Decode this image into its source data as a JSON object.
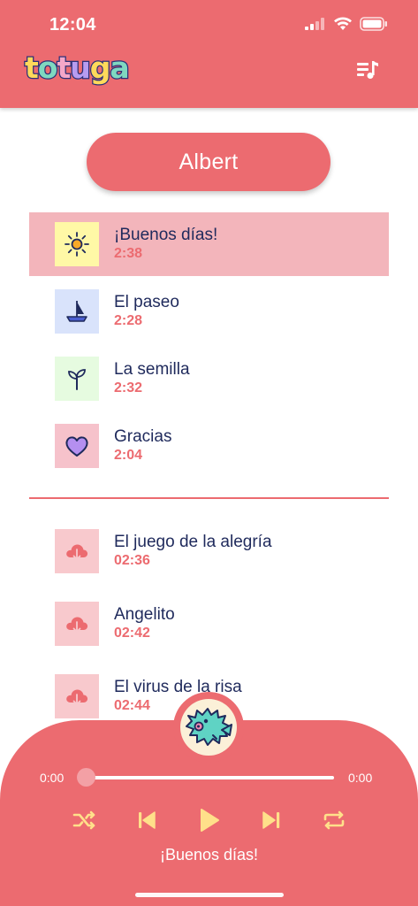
{
  "status_bar": {
    "time": "12:04"
  },
  "header": {
    "logo_letters": [
      {
        "char": "t",
        "color": "#ffd95a"
      },
      {
        "char": "o",
        "color": "#7fd8c0"
      },
      {
        "char": "t",
        "color": "#f5a7c8"
      },
      {
        "char": "u",
        "color": "#b79cf0"
      },
      {
        "char": "g",
        "color": "#ffd95a"
      },
      {
        "char": "a",
        "color": "#7fd8c0"
      }
    ],
    "queue_icon": "playlist-music-icon"
  },
  "profile": {
    "name": "Albert"
  },
  "playlist": [
    {
      "title": "¡Buenos días!",
      "duration": "2:38",
      "icon": "sun-icon",
      "icon_bg": "#fff8a6",
      "active": true
    },
    {
      "title": "El paseo",
      "duration": "2:28",
      "icon": "sailboat-icon",
      "icon_bg": "#d9e3fb",
      "active": false
    },
    {
      "title": "La semilla",
      "duration": "2:32",
      "icon": "sprout-icon",
      "icon_bg": "#e6fbe0",
      "active": false
    },
    {
      "title": "Gracias",
      "duration": "2:04",
      "icon": "heart-icon",
      "icon_bg": "#f6c2cb",
      "active": false
    }
  ],
  "downloads": [
    {
      "title": "El juego de la alegría",
      "duration": "02:36",
      "icon": "cloud-download-icon"
    },
    {
      "title": "Angelito",
      "duration": "02:42",
      "icon": "cloud-download-icon"
    },
    {
      "title": "El virus de la risa",
      "duration": "02:44",
      "icon": "cloud-download-icon"
    }
  ],
  "player": {
    "elapsed": "0:00",
    "total": "0:00",
    "progress": 0,
    "now_playing": "¡Buenos días!",
    "controls": [
      "shuffle-icon",
      "skip-previous-icon",
      "play-icon",
      "skip-next-icon",
      "repeat-icon"
    ]
  },
  "colors": {
    "brand": "#ec6b70",
    "active_row": "#f3b5bb",
    "title_text": "#1f2a5c",
    "accent_yellow": "#ffe08a"
  }
}
